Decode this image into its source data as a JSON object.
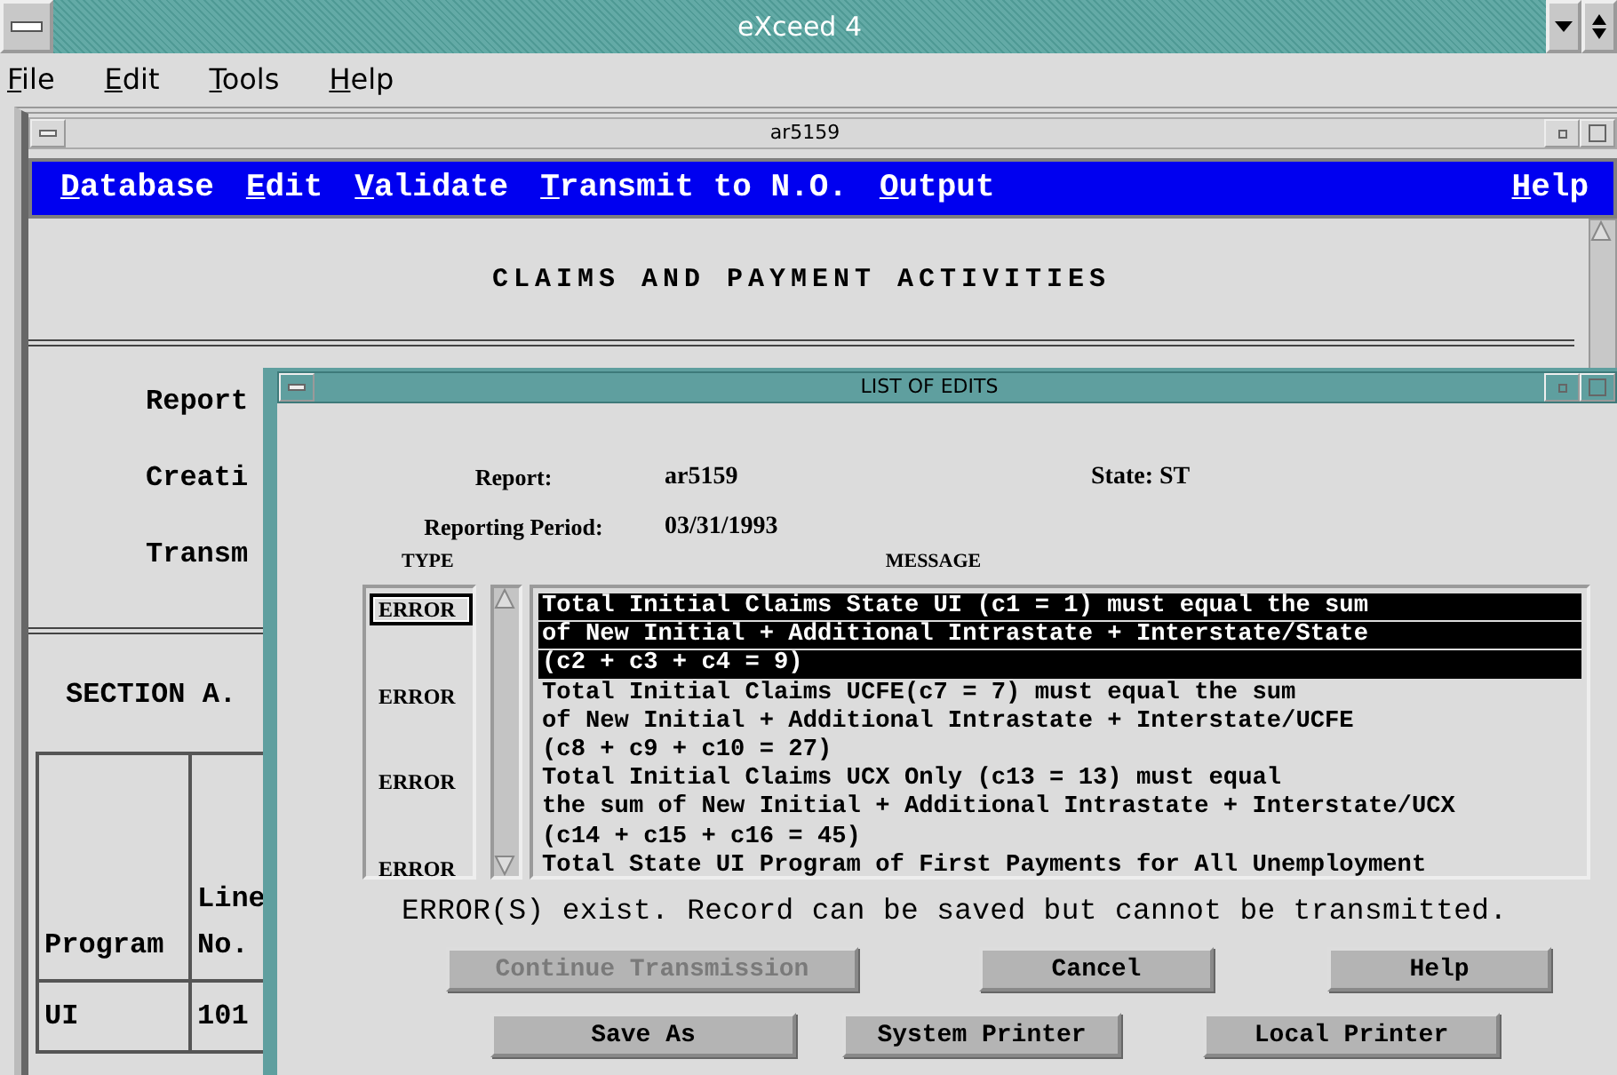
{
  "app": {
    "title": "eXceed 4",
    "menu": [
      "File",
      "Edit",
      "Tools",
      "Help"
    ]
  },
  "document": {
    "title": "ar5159",
    "menu": [
      "Database",
      "Edit",
      "Validate",
      "Transmit to N.O.",
      "Output"
    ],
    "help_menu": "Help",
    "heading": "CLAIMS AND PAYMENT ACTIVITIES",
    "fields": [
      "Report",
      "Creati",
      "Transm"
    ],
    "section": "SECTION A.",
    "table": {
      "columns": [
        "Program",
        "Line No."
      ],
      "rows": [
        [
          "UI",
          "101"
        ]
      ]
    }
  },
  "dialog": {
    "title": "LIST OF EDITS",
    "report_label": "Report:",
    "report_value": "ar5159",
    "state": "State: ST",
    "period_label": "Reporting Period:",
    "period_value": "03/31/1993",
    "type_heading": "TYPE",
    "message_heading": "MESSAGE",
    "entries": [
      {
        "type": "ERROR",
        "selected": true,
        "lines": [
          "Total Initial Claims State UI (c1 = 1) must equal the sum",
          "of New Initial + Additional Intrastate + Interstate/State",
          "(c2 + c3 + c4 = 9)"
        ]
      },
      {
        "type": "ERROR",
        "selected": false,
        "lines": [
          "Total Initial Claims UCFE(c7 = 7) must equal the sum",
          "of New Initial + Additional Intrastate + Interstate/UCFE",
          "(c8 + c9 + c10 = 27)"
        ]
      },
      {
        "type": "ERROR",
        "selected": false,
        "lines": [
          "Total Initial Claims UCX Only (c13 = 13) must equal",
          "the sum of New Initial + Additional Intrastate + Interstate/UCX",
          "(c14 + c15 + c16 = 45)"
        ]
      },
      {
        "type": "ERROR",
        "selected": false,
        "lines": [
          "Total State UI Program of First Payments for All Unemployment"
        ]
      }
    ],
    "status": "ERROR(S) exist. Record can be saved but cannot be transmitted.",
    "button_rows": [
      [
        {
          "label": "Continue Transmission",
          "disabled": true
        },
        {
          "label": "Cancel",
          "disabled": false
        },
        {
          "label": "Help",
          "disabled": false
        }
      ],
      [
        {
          "label": "Save As",
          "disabled": false
        },
        {
          "label": "System Printer",
          "disabled": false
        },
        {
          "label": "Local Printer",
          "disabled": false
        }
      ]
    ]
  }
}
